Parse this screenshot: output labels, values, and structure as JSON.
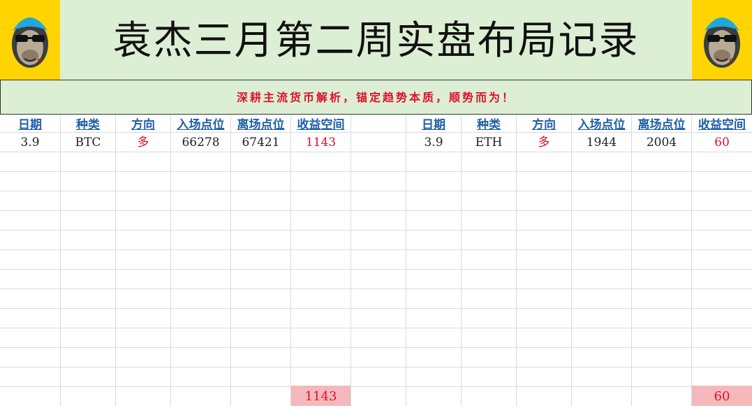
{
  "title": "袁杰三月第二周实盘布局记录",
  "subtitle": "深耕主流货币解析，锚定趋势本质，顺势而为！",
  "headers": [
    "日期",
    "种类",
    "方向",
    "入场点位",
    "离场点位",
    "收益空间"
  ],
  "left_table": {
    "rows": [
      {
        "date": "3.9",
        "kind": "BTC",
        "direction": "多",
        "entry": "66278",
        "exit": "67421",
        "profit": "1143"
      }
    ],
    "total": "1143"
  },
  "right_table": {
    "rows": [
      {
        "date": "3.9",
        "kind": "ETH",
        "direction": "多",
        "entry": "1944",
        "exit": "2004",
        "profit": "60"
      }
    ],
    "total": "60"
  },
  "colors": {
    "header_bg": "#dcefd4",
    "logo_bg": "#ffd400",
    "accent_red": "#e0102a",
    "header_blue": "#1f5fa8",
    "total_bg": "#f4b8bd"
  },
  "icons": [
    "monkey-logo-icon"
  ]
}
